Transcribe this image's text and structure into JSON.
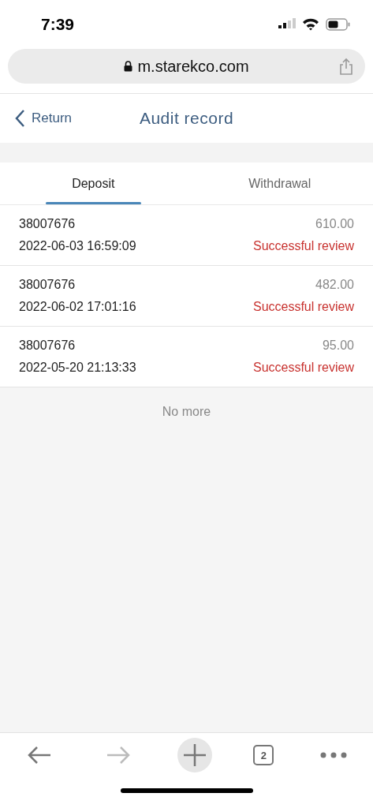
{
  "status_bar": {
    "time": "7:39"
  },
  "address_bar": {
    "url": "m.starekco.com"
  },
  "header": {
    "back_label": "Return",
    "title": "Audit record"
  },
  "tabs": [
    {
      "label": "Deposit",
      "selected": true
    },
    {
      "label": "Withdrawal",
      "selected": false
    }
  ],
  "records": [
    {
      "id": "38007676",
      "amount": "610.00",
      "time": "2022-06-03 16:59:09",
      "status": "Successful review"
    },
    {
      "id": "38007676",
      "amount": "482.00",
      "time": "2022-06-02 17:01:16",
      "status": "Successful review"
    },
    {
      "id": "38007676",
      "amount": "95.00",
      "time": "2022-05-20 21:13:33",
      "status": "Successful review"
    }
  ],
  "end_message": "No more",
  "toolbar": [
    {
      "kind": "back",
      "disabled": false
    },
    {
      "kind": "forward",
      "disabled": true
    },
    {
      "kind": "new-tab",
      "disabled": false
    },
    {
      "kind": "tabs",
      "label": "2",
      "disabled": false
    },
    {
      "kind": "more",
      "disabled": false
    }
  ]
}
